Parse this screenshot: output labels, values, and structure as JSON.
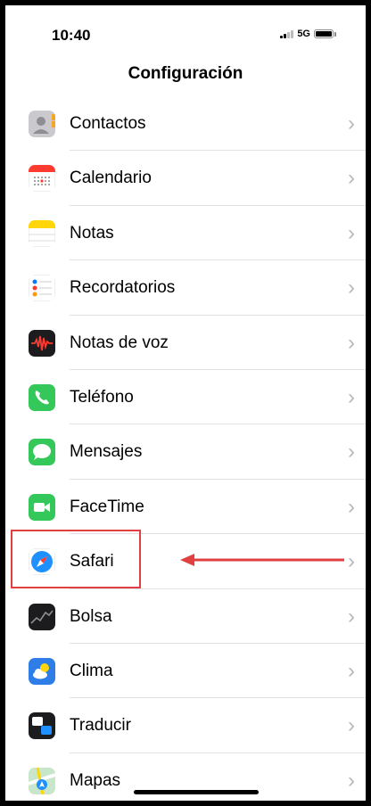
{
  "status_bar": {
    "time": "10:40",
    "network": "5G"
  },
  "nav": {
    "title": "Configuración"
  },
  "items": [
    {
      "label": "Contactos",
      "icon": "contacts-icon"
    },
    {
      "label": "Calendario",
      "icon": "calendar-icon"
    },
    {
      "label": "Notas",
      "icon": "notes-icon"
    },
    {
      "label": "Recordatorios",
      "icon": "reminders-icon"
    },
    {
      "label": "Notas de voz",
      "icon": "voice-memos-icon"
    },
    {
      "label": "Teléfono",
      "icon": "phone-icon"
    },
    {
      "label": "Mensajes",
      "icon": "messages-icon"
    },
    {
      "label": "FaceTime",
      "icon": "facetime-icon"
    },
    {
      "label": "Safari",
      "icon": "safari-icon"
    },
    {
      "label": "Bolsa",
      "icon": "stocks-icon"
    },
    {
      "label": "Clima",
      "icon": "weather-icon"
    },
    {
      "label": "Traducir",
      "icon": "translate-icon"
    },
    {
      "label": "Mapas",
      "icon": "maps-icon"
    }
  ],
  "chevron": "›",
  "colors": {
    "highlight": "#e04040",
    "separator": "#e2e2e6",
    "chevron": "#b8b8bd"
  }
}
